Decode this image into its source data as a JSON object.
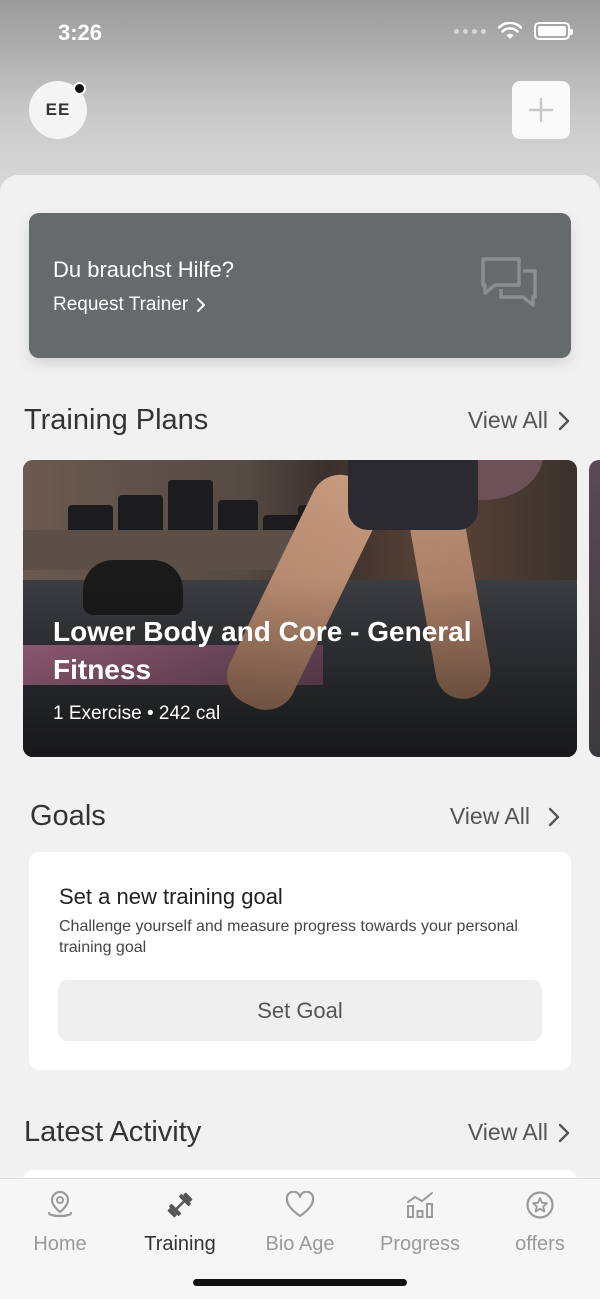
{
  "status_bar": {
    "time": "3:26"
  },
  "header": {
    "avatar_initials": "EE"
  },
  "help_card": {
    "title": "Du brauchst Hilfe?",
    "link_label": "Request Trainer"
  },
  "training_plans": {
    "title": "Training Plans",
    "view_all": "View All",
    "items": [
      {
        "title": "Lower Body and Core - General Fitness",
        "meta": "1 Exercise • 242 cal"
      }
    ]
  },
  "goals": {
    "title": "Goals",
    "view_all": "View All",
    "card": {
      "title": "Set a new training goal",
      "description": "Challenge yourself and measure progress towards your personal training goal",
      "button_label": "Set Goal"
    }
  },
  "latest_activity": {
    "title": "Latest Activity",
    "view_all": "View All"
  },
  "tab_bar": {
    "active": "Training",
    "tabs": [
      {
        "label": "Home",
        "icon": "home-pin-icon"
      },
      {
        "label": "Training",
        "icon": "dumbbell-icon"
      },
      {
        "label": "Bio Age",
        "icon": "heart-icon"
      },
      {
        "label": "Progress",
        "icon": "bar-chart-icon"
      },
      {
        "label": "offers",
        "icon": "star-badge-icon"
      }
    ]
  },
  "colors": {
    "help_card_bg": "#656a6a",
    "background": "#f1f1f1",
    "tab_active": "#333333",
    "tab_inactive": "#9a9a9a"
  }
}
